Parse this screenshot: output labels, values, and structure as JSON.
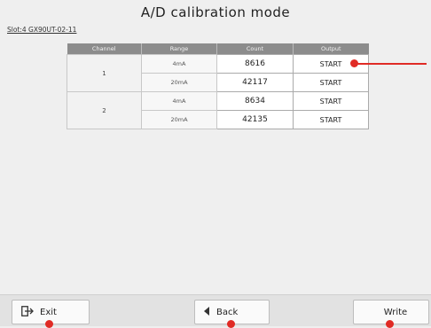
{
  "header": {
    "title": "A/D calibration mode",
    "slot": "Slot:4  GX90UT-02-11"
  },
  "table": {
    "columns": [
      "Channel",
      "Range",
      "Count",
      "Output"
    ],
    "rows": [
      {
        "channel": "1",
        "range": "4mA",
        "count": "8616",
        "output": "START"
      },
      {
        "channel": "1",
        "range": "20mA",
        "count": "42117",
        "output": "START"
      },
      {
        "channel": "2",
        "range": "4mA",
        "count": "8634",
        "output": "START"
      },
      {
        "channel": "2",
        "range": "20mA",
        "count": "42135",
        "output": "START"
      }
    ]
  },
  "footer": {
    "exit_label": "Exit",
    "back_label": "Back",
    "write_label": "Write"
  },
  "icons": {
    "exit": "exit-icon",
    "back": "back-arrow-icon"
  },
  "colors": {
    "callout": "#e02b25",
    "header_bg": "#8c8c8c"
  }
}
